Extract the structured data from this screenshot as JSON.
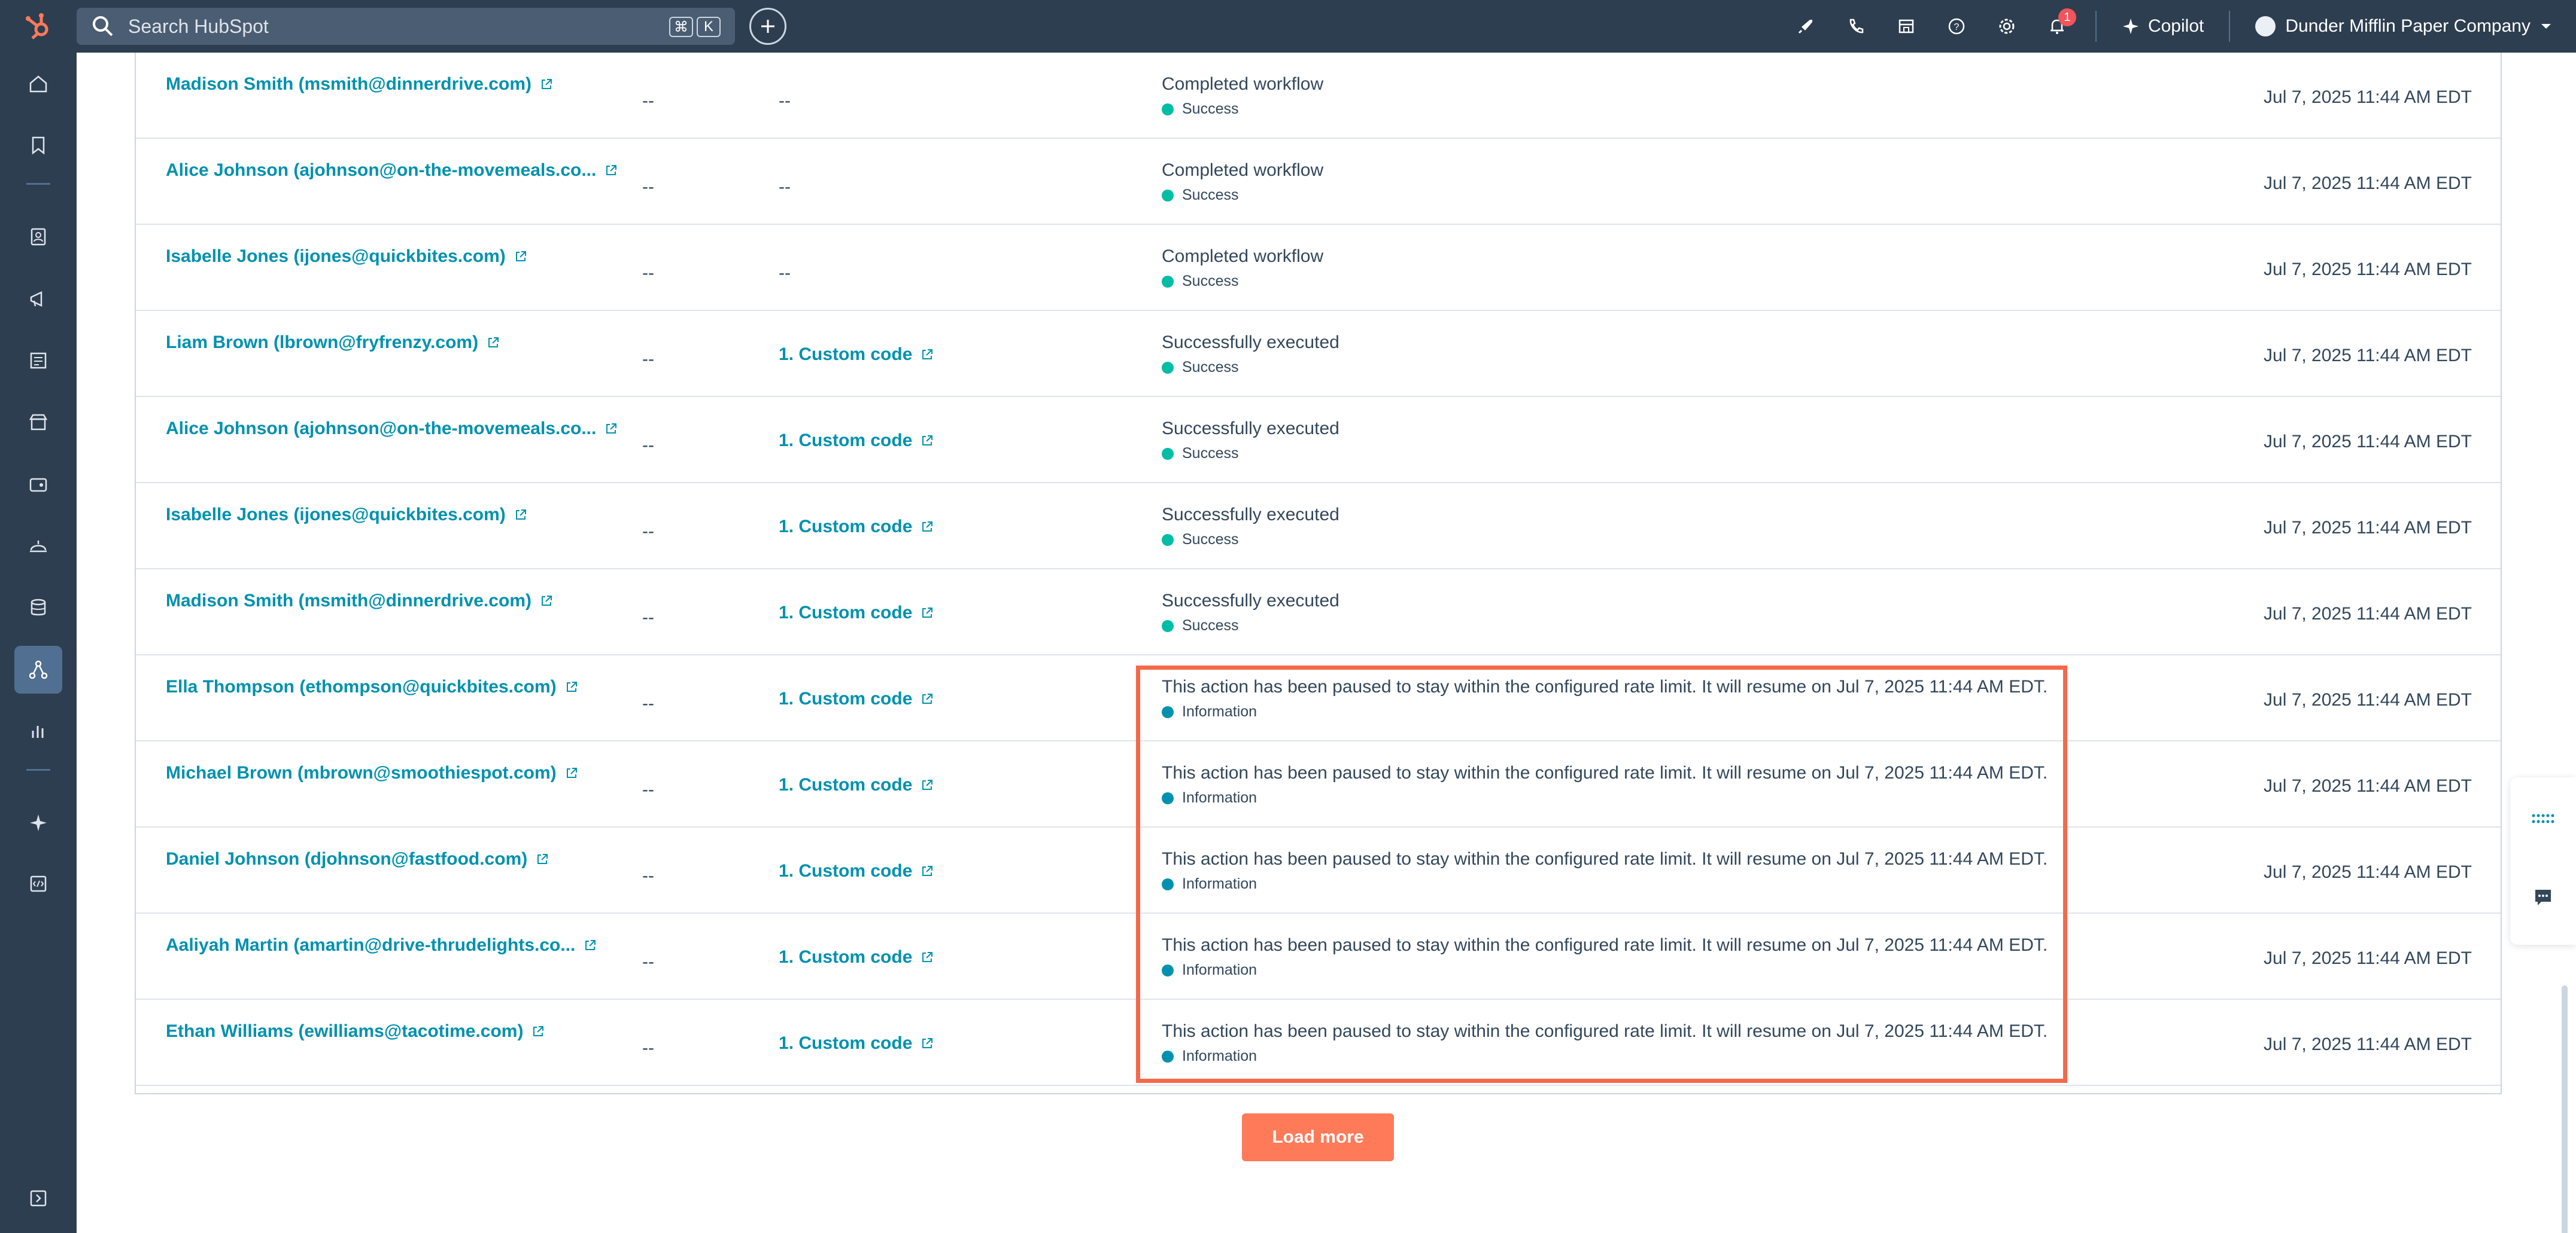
{
  "topbar": {
    "search_placeholder": "Search HubSpot",
    "shortcut_keys": [
      "⌘",
      "K"
    ],
    "notification_count": "1",
    "copilot_label": "Copilot",
    "account_name": "Dunder Mifflin Paper Company"
  },
  "colors": {
    "success": "#00bda5",
    "information": "#0091ae",
    "highlight": "#f5694a",
    "load_more": "#ff7a59"
  },
  "rows": [
    {
      "contact": "Madison Smith (msmith@dinnerdrive.com)",
      "col2": "--",
      "action": "--",
      "action_link": false,
      "result": "Completed workflow",
      "status": "Success",
      "status_type": "success",
      "date": "Jul 7, 2025 11:44 AM EDT"
    },
    {
      "contact": "Alice Johnson (ajohnson@on-the-movemeals.co...",
      "col2": "--",
      "action": "--",
      "action_link": false,
      "result": "Completed workflow",
      "status": "Success",
      "status_type": "success",
      "date": "Jul 7, 2025 11:44 AM EDT"
    },
    {
      "contact": "Isabelle Jones (ijones@quickbites.com)",
      "col2": "--",
      "action": "--",
      "action_link": false,
      "result": "Completed workflow",
      "status": "Success",
      "status_type": "success",
      "date": "Jul 7, 2025 11:44 AM EDT"
    },
    {
      "contact": "Liam Brown (lbrown@fryfrenzy.com)",
      "col2": "--",
      "action": "1. Custom code",
      "action_link": true,
      "result": "Successfully executed",
      "status": "Success",
      "status_type": "success",
      "date": "Jul 7, 2025 11:44 AM EDT"
    },
    {
      "contact": "Alice Johnson (ajohnson@on-the-movemeals.co...",
      "col2": "--",
      "action": "1. Custom code",
      "action_link": true,
      "result": "Successfully executed",
      "status": "Success",
      "status_type": "success",
      "date": "Jul 7, 2025 11:44 AM EDT"
    },
    {
      "contact": "Isabelle Jones (ijones@quickbites.com)",
      "col2": "--",
      "action": "1. Custom code",
      "action_link": true,
      "result": "Successfully executed",
      "status": "Success",
      "status_type": "success",
      "date": "Jul 7, 2025 11:44 AM EDT"
    },
    {
      "contact": "Madison Smith (msmith@dinnerdrive.com)",
      "col2": "--",
      "action": "1. Custom code",
      "action_link": true,
      "result": "Successfully executed",
      "status": "Success",
      "status_type": "success",
      "date": "Jul 7, 2025 11:44 AM EDT"
    },
    {
      "contact": "Ella Thompson (ethompson@quickbites.com)",
      "col2": "--",
      "action": "1. Custom code",
      "action_link": true,
      "result": "This action has been paused to stay within the configured rate limit. It will resume on Jul 7, 2025 11:44 AM EDT.",
      "status": "Information",
      "status_type": "information",
      "date": "Jul 7, 2025 11:44 AM EDT"
    },
    {
      "contact": "Michael Brown (mbrown@smoothiespot.com)",
      "col2": "--",
      "action": "1. Custom code",
      "action_link": true,
      "result": "This action has been paused to stay within the configured rate limit. It will resume on Jul 7, 2025 11:44 AM EDT.",
      "status": "Information",
      "status_type": "information",
      "date": "Jul 7, 2025 11:44 AM EDT"
    },
    {
      "contact": "Daniel Johnson (djohnson@fastfood.com)",
      "col2": "--",
      "action": "1. Custom code",
      "action_link": true,
      "result": "This action has been paused to stay within the configured rate limit. It will resume on Jul 7, 2025 11:44 AM EDT.",
      "status": "Information",
      "status_type": "information",
      "date": "Jul 7, 2025 11:44 AM EDT"
    },
    {
      "contact": "Aaliyah Martin (amartin@drive-thrudelights.co...",
      "col2": "--",
      "action": "1. Custom code",
      "action_link": true,
      "result": "This action has been paused to stay within the configured rate limit. It will resume on Jul 7, 2025 11:44 AM EDT.",
      "status": "Information",
      "status_type": "information",
      "date": "Jul 7, 2025 11:44 AM EDT"
    },
    {
      "contact": "Ethan Williams (ewilliams@tacotime.com)",
      "col2": "--",
      "action": "1. Custom code",
      "action_link": true,
      "result": "This action has been paused to stay within the configured rate limit. It will resume on Jul 7, 2025 11:44 AM EDT.",
      "status": "Information",
      "status_type": "information",
      "date": "Jul 7, 2025 11:44 AM EDT"
    }
  ],
  "load_more_label": "Load more",
  "sidebar_icons": [
    "home-icon",
    "bookmark-icon",
    "contacts-icon",
    "marketing-icon",
    "content-icon",
    "commerce-icon",
    "sales-icon",
    "service-icon",
    "data-icon",
    "automation-icon",
    "reporting-icon",
    "breeze-icon",
    "development-icon",
    "expand-icon"
  ]
}
